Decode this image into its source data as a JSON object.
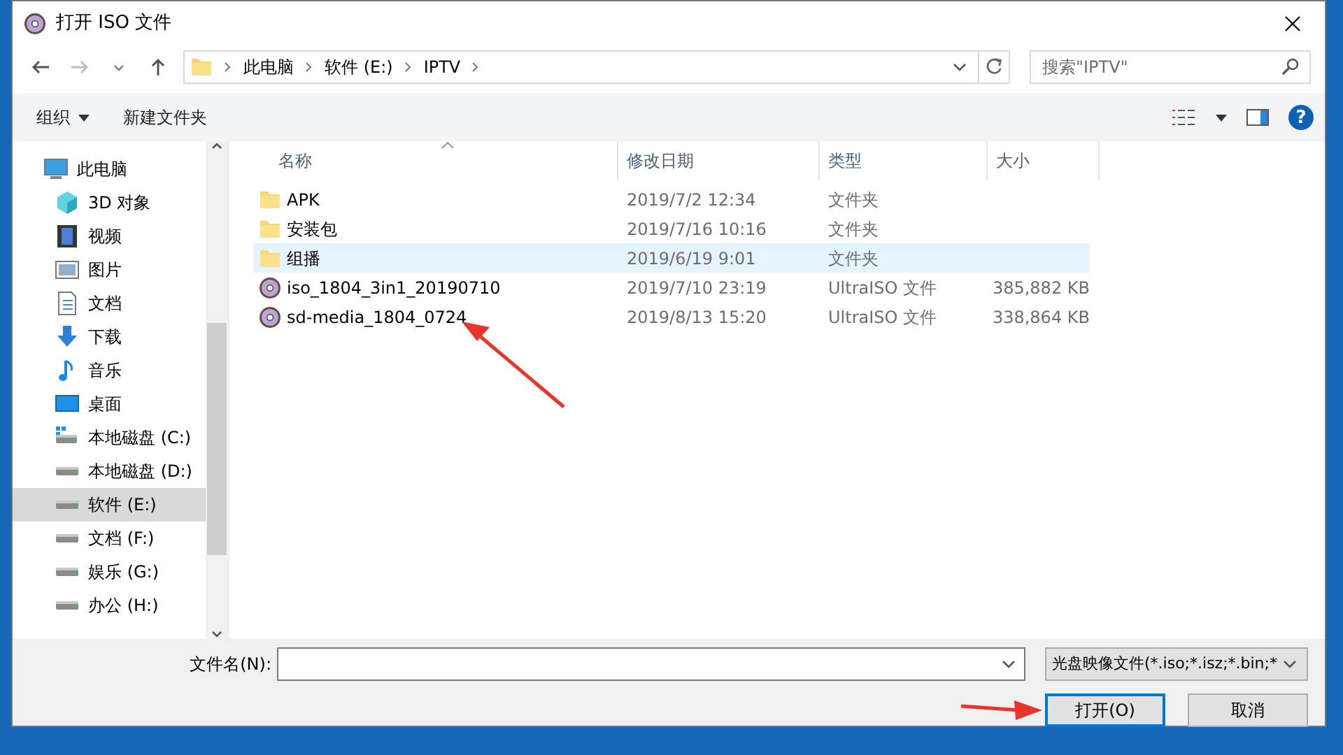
{
  "window": {
    "title": "打开 ISO 文件"
  },
  "address": {
    "crumbs": [
      "此电脑",
      "软件 (E:)",
      "IPTV"
    ]
  },
  "search": {
    "placeholder": "搜索\"IPTV\""
  },
  "toolbar": {
    "organize": "组织",
    "new_folder": "新建文件夹",
    "help": "?"
  },
  "sidebar": {
    "items": [
      {
        "label": "此电脑",
        "kind": "pc",
        "selected": false,
        "indent": false
      },
      {
        "label": "3D 对象",
        "kind": "cube",
        "selected": false,
        "indent": true
      },
      {
        "label": "视频",
        "kind": "video",
        "selected": false,
        "indent": true
      },
      {
        "label": "图片",
        "kind": "picture",
        "selected": false,
        "indent": true
      },
      {
        "label": "文档",
        "kind": "document",
        "selected": false,
        "indent": true
      },
      {
        "label": "下载",
        "kind": "download",
        "selected": false,
        "indent": true
      },
      {
        "label": "音乐",
        "kind": "music",
        "selected": false,
        "indent": true
      },
      {
        "label": "桌面",
        "kind": "desktop",
        "selected": false,
        "indent": true
      },
      {
        "label": "本地磁盘 (C:)",
        "kind": "system-drive",
        "selected": false,
        "indent": true
      },
      {
        "label": "本地磁盘 (D:)",
        "kind": "drive",
        "selected": false,
        "indent": true
      },
      {
        "label": "软件 (E:)",
        "kind": "drive",
        "selected": true,
        "indent": true
      },
      {
        "label": "文档 (F:)",
        "kind": "drive",
        "selected": false,
        "indent": true
      },
      {
        "label": "娱乐 (G:)",
        "kind": "drive",
        "selected": false,
        "indent": true
      },
      {
        "label": "办公 (H:)",
        "kind": "drive",
        "selected": false,
        "indent": true
      }
    ]
  },
  "table": {
    "columns": [
      {
        "label": "名称",
        "sorted": true
      },
      {
        "label": "修改日期",
        "sorted": false
      },
      {
        "label": "类型",
        "sorted": false
      },
      {
        "label": "大小",
        "sorted": false
      }
    ],
    "rows": [
      {
        "kind": "folder",
        "selected": false,
        "name": "APK",
        "date": "2019/7/2 12:34",
        "type": "文件夹"
      },
      {
        "kind": "folder",
        "selected": false,
        "name": "安装包",
        "date": "2019/7/16 10:16",
        "type": "文件夹"
      },
      {
        "kind": "folder",
        "selected": true,
        "name": "组播",
        "date": "2019/6/19 9:01",
        "type": "文件夹"
      },
      {
        "kind": "iso",
        "selected": false,
        "name": "iso_1804_3in1_20190710",
        "date": "2019/7/10 23:19",
        "type": "UltraISO 文件",
        "size": "385,882 KB"
      },
      {
        "kind": "iso",
        "selected": false,
        "name": "sd-media_1804_0724",
        "date": "2019/8/13 15:20",
        "type": "UltraISO 文件",
        "size": "338,864 KB"
      }
    ]
  },
  "footer": {
    "filename_label": "文件名(N):",
    "filter": "光盘映像文件(*.iso;*.isz;*.bin;*",
    "buttons": [
      {
        "label": "打开(O)",
        "default": true
      },
      {
        "label": "取消",
        "default": false
      }
    ]
  }
}
